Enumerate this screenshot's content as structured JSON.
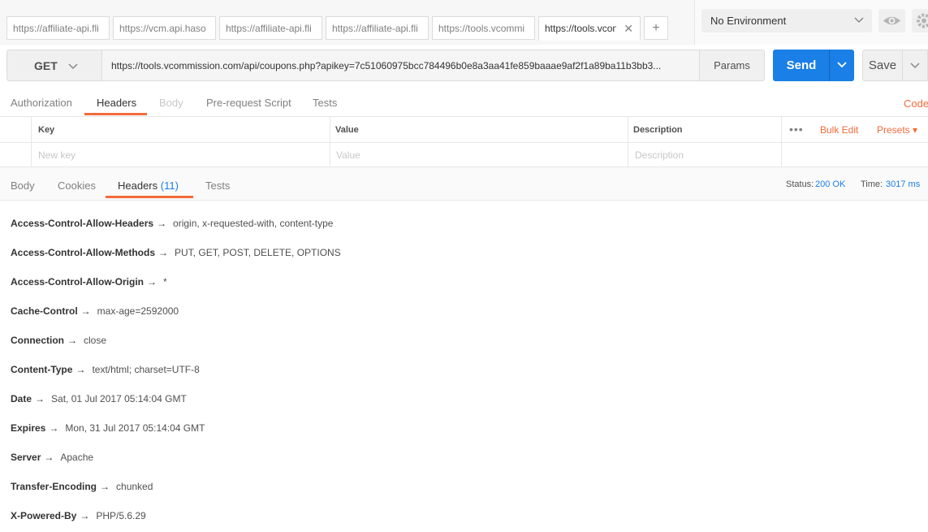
{
  "request_tabs": [
    {
      "label": "https://affiliate-api.flipk",
      "active": false
    },
    {
      "label": "https://vcm.api.hasoffe",
      "active": false
    },
    {
      "label": "https://affiliate-api.flipk",
      "active": false
    },
    {
      "label": "https://affiliate-api.flipk",
      "active": false
    },
    {
      "label": "https://tools.vcommiss",
      "active": false
    },
    {
      "label": "https://tools.vcon",
      "active": true
    }
  ],
  "new_tab_label": "+",
  "environment": {
    "selected": "No Environment"
  },
  "request": {
    "method": "GET",
    "url": "https://tools.vcommission.com/api/coupons.php?apikey=7c51060975bcc784496b0e8a3aa41fe859baaae9af2f1a89ba11b3bb3...",
    "params_label": "Params",
    "send_label": "Send",
    "save_label": "Save"
  },
  "request_subtabs": [
    {
      "label": "Authorization",
      "state": "normal"
    },
    {
      "label": "Headers",
      "state": "active"
    },
    {
      "label": "Body",
      "state": "disabled"
    },
    {
      "label": "Pre-request Script",
      "state": "normal"
    },
    {
      "label": "Tests",
      "state": "normal"
    }
  ],
  "code_label": "Code",
  "headers_table": {
    "columns": [
      "Key",
      "Value",
      "Description"
    ],
    "placeholders": {
      "key": "New key",
      "value": "Value",
      "description": "Description"
    },
    "more_icon": "•••",
    "bulk_edit_label": "Bulk Edit",
    "presets_label": "Presets ▾"
  },
  "response_tabs": [
    {
      "label": "Body",
      "active": false,
      "count": ""
    },
    {
      "label": "Cookies",
      "active": false,
      "count": ""
    },
    {
      "label": "Headers",
      "active": true,
      "count": "(11)"
    },
    {
      "label": "Tests",
      "active": false,
      "count": ""
    }
  ],
  "response_meta": {
    "status_label": "Status:",
    "status_value": "200 OK",
    "time_label": "Time:",
    "time_value": "3017 ms"
  },
  "response_headers": [
    {
      "key": "Access-Control-Allow-Headers",
      "value": "origin, x-requested-with, content-type"
    },
    {
      "key": "Access-Control-Allow-Methods",
      "value": "PUT, GET, POST, DELETE, OPTIONS"
    },
    {
      "key": "Access-Control-Allow-Origin",
      "value": "*"
    },
    {
      "key": "Cache-Control",
      "value": "max-age=2592000"
    },
    {
      "key": "Connection",
      "value": "close"
    },
    {
      "key": "Content-Type",
      "value": "text/html; charset=UTF-8"
    },
    {
      "key": "Date",
      "value": "Sat, 01 Jul 2017 05:14:04 GMT"
    },
    {
      "key": "Expires",
      "value": "Mon, 31 Jul 2017 05:14:04 GMT"
    },
    {
      "key": "Server",
      "value": "Apache"
    },
    {
      "key": "Transfer-Encoding",
      "value": "chunked"
    },
    {
      "key": "X-Powered-By",
      "value": "PHP/5.6.29"
    }
  ],
  "arrow_glyph": "→",
  "colors": {
    "accent": "#f26b3a",
    "primary": "#1a7fe6"
  }
}
